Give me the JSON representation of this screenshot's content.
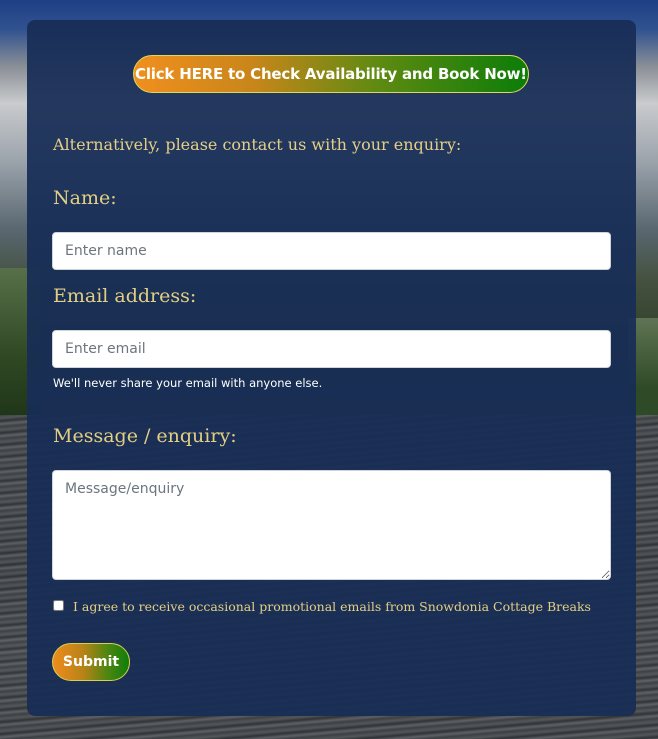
{
  "book_button": {
    "label": "Click HERE to Check Availability and Book Now!"
  },
  "form": {
    "intro": "Alternatively, please contact us with your enquiry:",
    "name": {
      "label": "Name:",
      "placeholder": "Enter name",
      "value": ""
    },
    "email": {
      "label": "Email address:",
      "placeholder": "Enter email",
      "value": "",
      "help": "We'll never share your email with anyone else."
    },
    "message": {
      "label": "Message / enquiry:",
      "placeholder": "Message/enquiry",
      "value": ""
    },
    "agree": {
      "label": "I agree to receive occasional promotional emails from Snowdonia Cottage Breaks",
      "checked": false
    },
    "submit_label": "Submit"
  },
  "colors": {
    "card_background": "#182d56",
    "label_gold": "#e3cf84",
    "gradient_orange": "#f08f1e",
    "gradient_green": "#0b7d08"
  }
}
